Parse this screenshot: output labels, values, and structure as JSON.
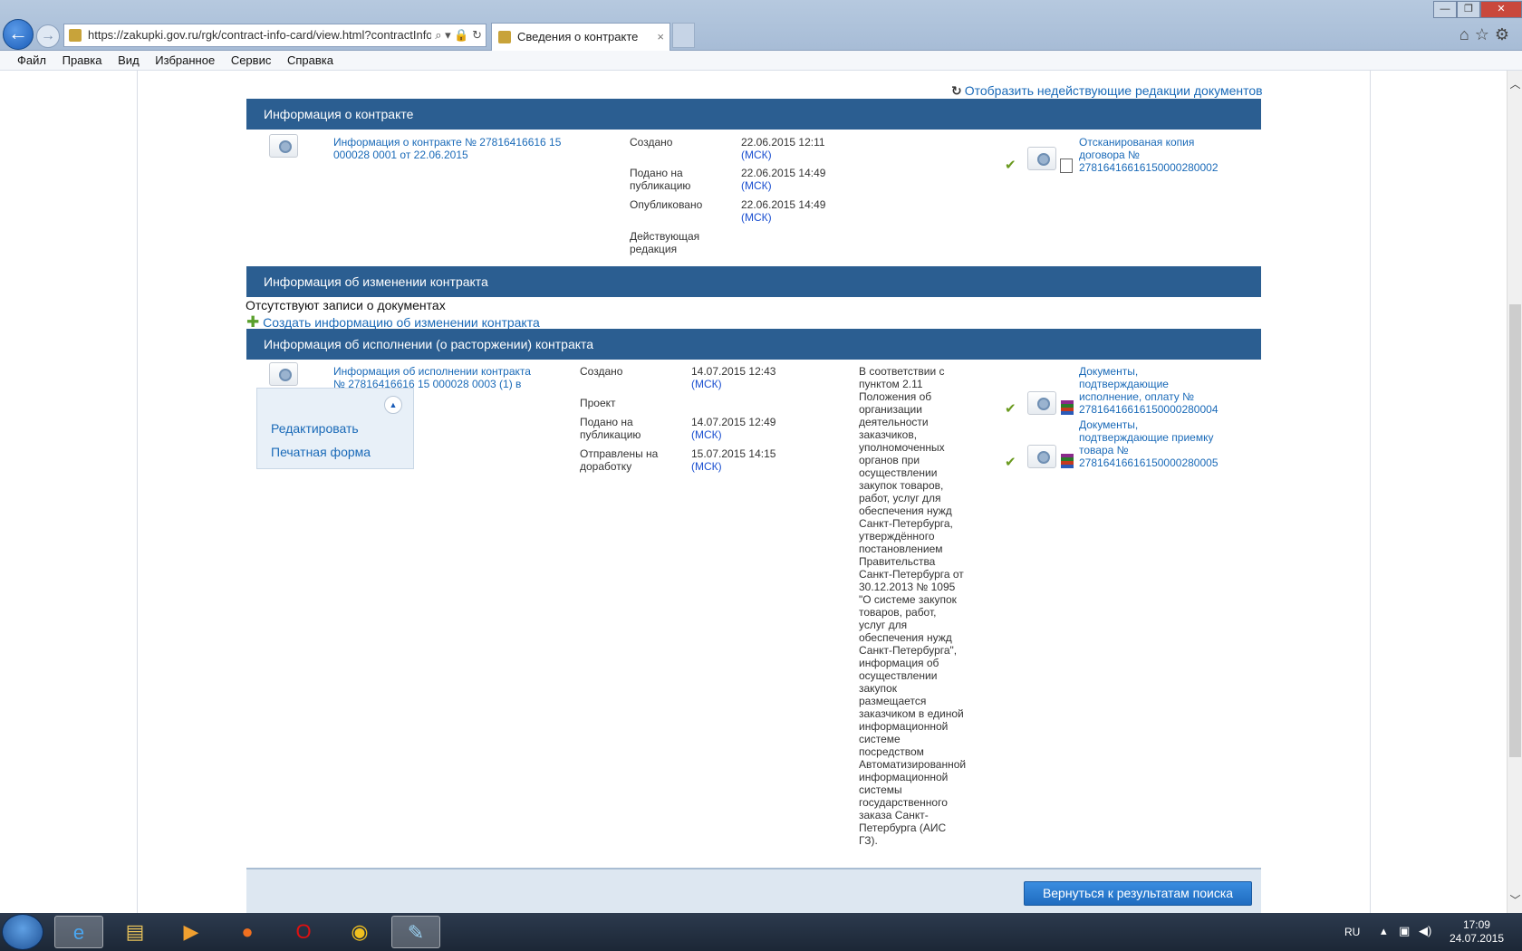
{
  "browser": {
    "url": "https://zakupki.gov.ru/rgk/contract-info-card/view.html?contractInfo",
    "url_controls": "⌕ ▾ 🔒 ↻",
    "tab_title": "Сведения о контракте",
    "tab_close": "×",
    "menu": [
      "Файл",
      "Правка",
      "Вид",
      "Избранное",
      "Сервис",
      "Справка"
    ],
    "window_controls": [
      "—",
      "❐",
      "✕"
    ],
    "right_icons": "⌂☆⚙"
  },
  "page": {
    "show_invalid_link": "Отобразить недействующие редакции документов",
    "contract_info": {
      "header": "Информация о контракте",
      "title_link_line1": "Информация о контракте № 27816416616 15",
      "title_link_line2": "000028 0001 от 22.06.2015",
      "rows": [
        {
          "label_l1": "Создано",
          "label_l2": "",
          "date": "22.06.2015 12:11",
          "tz": "(МСК)"
        },
        {
          "label_l1": "Подано на",
          "label_l2": "публикацию",
          "date": "22.06.2015 14:49",
          "tz": "(МСК)"
        },
        {
          "label_l1": "Опубликовано",
          "label_l2": "",
          "date": "22.06.2015 14:49",
          "tz": "(МСК)"
        },
        {
          "label_l1": "Действующая",
          "label_l2": "редакция",
          "date": "",
          "tz": ""
        }
      ],
      "doc_l1": "Отсканированая копия",
      "doc_l2": "договора №",
      "doc_l3": "27816416616150000280002"
    },
    "change_info": {
      "header": "Информация об изменении контракта",
      "empty": "Отсутствуют записи о документах",
      "create_link": "Создать информацию об изменении контракта"
    },
    "execution_info": {
      "header": "Информация об исполнении (о расторжении) контракта",
      "title_link_line1": "Информация об исполнении контракта",
      "title_link_line2": "№ 27816416616 15 000028 0003 (1) в",
      "rows": [
        {
          "label_l1": "Создано",
          "label_l2": "",
          "date": "14.07.2015 12:43",
          "tz": "(МСК)"
        },
        {
          "label_l1": "Проект",
          "label_l2": "",
          "date": "",
          "tz": ""
        },
        {
          "label_l1": "Подано на",
          "label_l2": "публикацию",
          "date": "14.07.2015 12:49",
          "tz": "(МСК)"
        },
        {
          "label_l1": "Отправлены на",
          "label_l2": "доработку",
          "date": "15.07.2015 14:15",
          "tz": "(МСК)"
        }
      ],
      "note_lines": [
        "В соответствии с",
        "пунктом 2.11",
        "Положения об",
        "организации",
        "деятельности",
        "заказчиков,",
        "уполномоченных",
        "органов при",
        "осуществлении",
        "закупок товаров,",
        "работ, услуг для",
        "обеспечения нужд",
        "Санкт-Петербурга,",
        "утверждённого",
        "постановлением",
        "Правительства",
        "Санкт-Петербурга от",
        "30.12.2013 № 1095",
        "\"О системе закупок",
        "товаров, работ,",
        "услуг для",
        "обеспечения нужд",
        "Санкт-Петербурга\",",
        "информация об",
        "осуществлении",
        "закупок",
        "размещается",
        "заказчиком в единой",
        "информационной",
        "системе",
        "посредством",
        "Автоматизированной",
        "информационной",
        "системы",
        "государственного",
        "заказа Санкт-",
        "Петербурга (АИС",
        "ГЗ)."
      ],
      "docs": [
        {
          "l1": "Документы,",
          "l2": "подтверждающие",
          "l3": "исполнение, оплату №",
          "l4": "27816416616150000280004"
        },
        {
          "l1": "Документы,",
          "l2": "подтверждающие приемку",
          "l3": "товара №",
          "l4": "27816416616150000280005"
        }
      ]
    },
    "popup_menu": [
      "Редактировать",
      "Печатная форма"
    ],
    "return_button": "Вернуться к результатам поиска"
  },
  "taskbar": {
    "lang": "RU",
    "time": "17:09",
    "date": "24.07.2015"
  }
}
